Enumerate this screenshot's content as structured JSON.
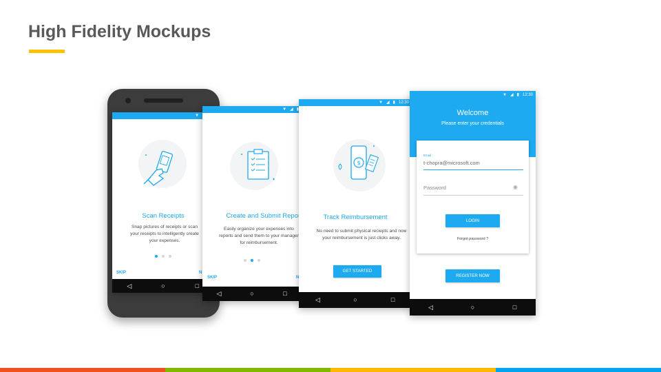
{
  "slide": {
    "title": "High Fidelity Mockups",
    "accent_color": "#ffc000",
    "footer_colors": [
      "#f25022",
      "#7fba00",
      "#ffb900",
      "#00a4ef"
    ]
  },
  "status": {
    "time": "12:30"
  },
  "screen1": {
    "title": "Scan Receipts",
    "description": "Snap pictures of receipts or scan your receipts to intelligently create your expenses.",
    "skip": "SKIP",
    "next": "N",
    "illustration": "hand-phone-receipt-icon"
  },
  "screen2": {
    "title": "Create and Submit Reports",
    "description": "Easily organize your expenses into reports and send them to your manager for reimbursement.",
    "skip": "SKIP",
    "next": "N",
    "illustration": "clipboard-checklist-icon"
  },
  "screen3": {
    "title": "Track Reimbursement",
    "description": "No need to submit physical reciepts and now your reimbursement is just clicks away.",
    "button": "GET STARTED",
    "illustration": "phone-dollar-icon"
  },
  "login": {
    "title": "Welcome",
    "subtitle": "Please enter your credentials",
    "email_label": "Email",
    "email_value": "t-chopra@microsoft.com",
    "password_placeholder": "Password",
    "login_button": "LOGIN",
    "forgot": "Forgot password ?",
    "register_button": "REGISTER NOW"
  },
  "colors": {
    "primary": "#1eaaf1",
    "navbar": "#0d0d0d",
    "phone_frame": "#3c3c3c"
  }
}
